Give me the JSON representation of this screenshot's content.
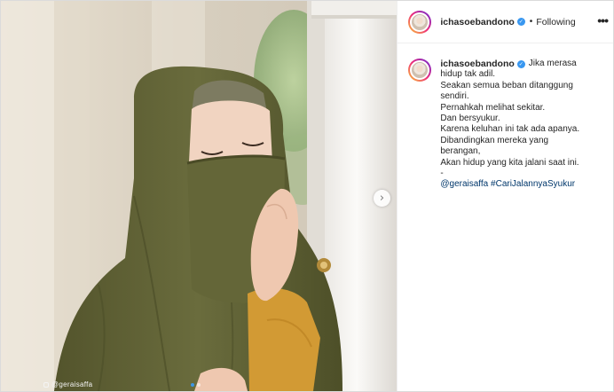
{
  "post": {
    "image_alt": "Woman in olive-green hijab and niqab leaning against white pillar",
    "watermark": "@geraisaffa",
    "carousel": {
      "total": 2,
      "active": 0
    }
  },
  "header": {
    "username": "ichasoebandono",
    "separator": "•",
    "follow_label": "Following",
    "more_label": "•••"
  },
  "caption": {
    "username": "ichasoebandono",
    "first_line": "Jika merasa",
    "lines": [
      "hidup tak adil.",
      "Seakan semua beban ditanggung",
      "sendiri.",
      "Pernahkah melihat sekitar.",
      "Dan bersyukur.",
      "Karena keluhan ini tak ada apanya.",
      "Dibandingkan mereka yang",
      "berangan,",
      "Akan hidup yang kita jalani saat ini.",
      "-"
    ],
    "mention": "@geraisaffa",
    "hashtag": "#CariJalannyaSyukur"
  },
  "colors": {
    "accent": "#3897f0",
    "link": "#00376b",
    "hijab": "#5f6236",
    "mustard": "#d29a34"
  }
}
